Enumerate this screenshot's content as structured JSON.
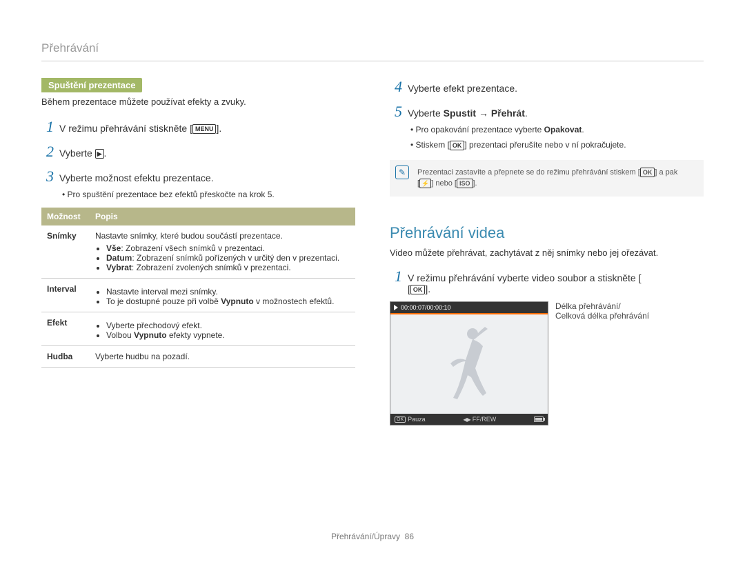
{
  "header": "Přehrávání",
  "left": {
    "tag": "Spuštění prezentace",
    "intro": "Během prezentace můžete používat efekty a zvuky.",
    "step1_a": "V režimu přehrávání stiskněte [",
    "step1_menu": "MENU",
    "step1_b": "].",
    "step2_a": "Vyberte ",
    "step2_b": ".",
    "step3": "Vyberte možnost efektu prezentace.",
    "step3_sub": "Pro spuštění prezentace bez efektů přeskočte na krok 5.",
    "table": {
      "h1": "Možnost",
      "h2": "Popis",
      "rows": [
        {
          "name": "Snímky",
          "lead": "Nastavte snímky, které budou součástí prezentace.",
          "b1a": "Vše",
          "b1b": ": Zobrazení všech snímků v prezentaci.",
          "b2a": "Datum",
          "b2b": ": Zobrazení snímků pořízených v určitý den v prezentaci.",
          "b3a": "Vybrat",
          "b3b": ": Zobrazení zvolených snímků v prezentaci."
        },
        {
          "name": "Interval",
          "b1": "Nastavte interval mezi snímky.",
          "b2a": "To je dostupné pouze při volbě ",
          "b2bold": "Vypnuto",
          "b2b": " v možnostech efektů."
        },
        {
          "name": "Efekt",
          "b1": "Vyberte přechodový efekt.",
          "b2a": "Volbou ",
          "b2bold": "Vypnuto",
          "b2b": " efekty vypnete."
        },
        {
          "name": "Hudba",
          "text": "Vyberte hudbu na pozadí."
        }
      ]
    }
  },
  "right": {
    "step4": "Vyberte efekt prezentace.",
    "step5a": "Vyberte ",
    "step5b": "Spustit",
    "step5arrow": " → ",
    "step5c": "Přehrát",
    "step5d": ".",
    "sub1a": "Pro opakování prezentace vyberte ",
    "sub1b": "Opakovat",
    "sub1c": ".",
    "sub2a": "Stiskem [",
    "sub2ok": "OK",
    "sub2b": "] prezentaci přerušíte nebo v ní pokračujete.",
    "note_a": "Prezentaci zastavíte a přepnete se do režimu přehrávání stiskem [",
    "note_ok": "OK",
    "note_b": "] a pak",
    "note_c": "[",
    "note_flash": "⚡",
    "note_d": "] nebo [",
    "note_iso": "ISO",
    "note_e": "].",
    "h2": "Přehrávání videa",
    "vid_desc": "Video můžete přehrávat, zachytávat z něj snímky nebo jej ořezávat.",
    "vstep1a": "V režimu přehrávání vyberte video soubor a stiskněte [",
    "vstep1_ok": "OK",
    "vstep1b": "].",
    "timecode": "00:00:07/00:00:10",
    "pauza": "Pauza",
    "ffrew": "FF/REW",
    "ok_small": "OK",
    "callout1": "Délka přehrávání/",
    "callout2": "Celková délka přehrávání"
  },
  "footer_a": "Přehrávání/Úpravy",
  "footer_b": "86"
}
